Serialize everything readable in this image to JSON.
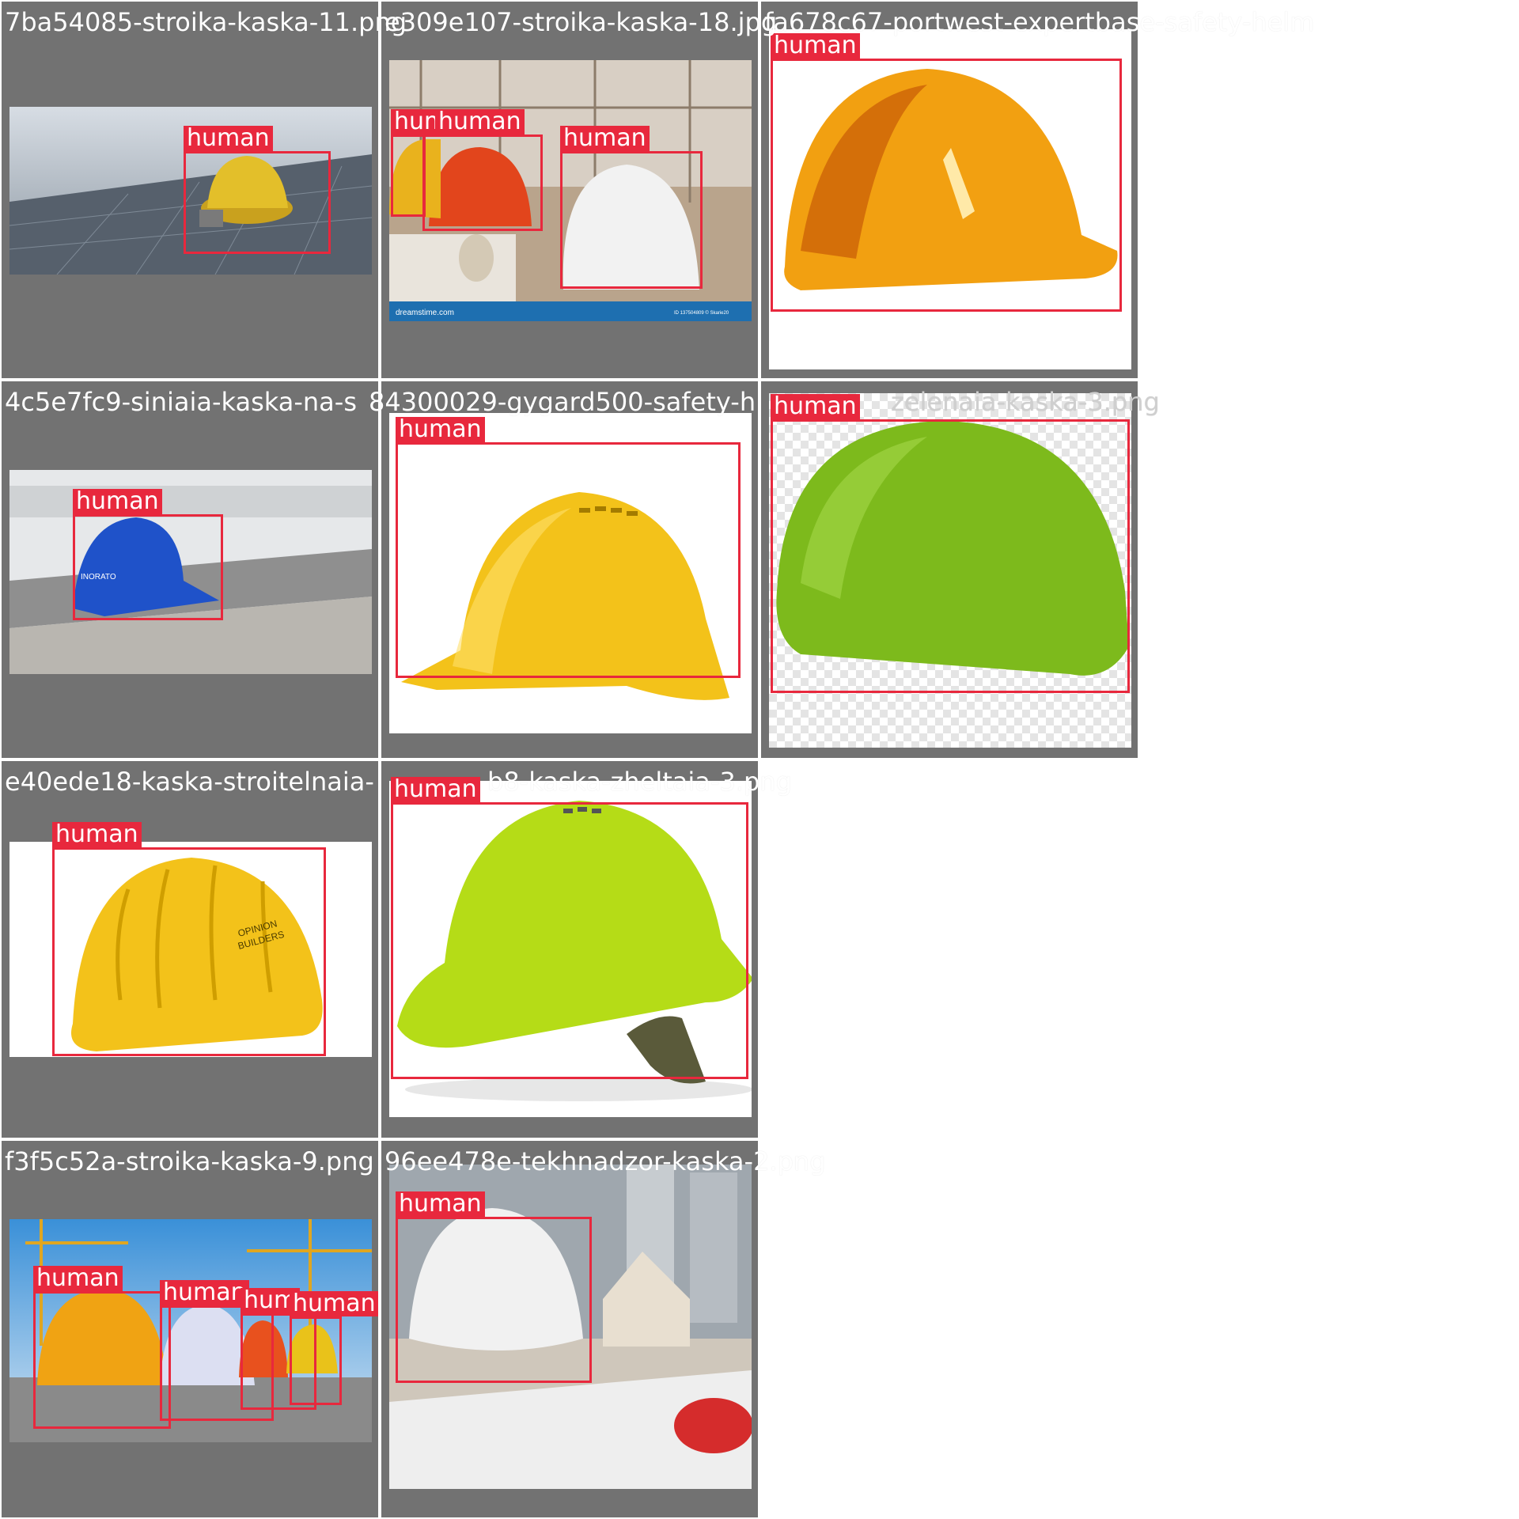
{
  "colors": {
    "tile_bg": "#727272",
    "box": "#e8283d",
    "label_text": "#ffffff"
  },
  "detection_class": "human",
  "tiles": [
    {
      "title": "7ba54085-stroika-kaska-11.png",
      "labels": [
        "human"
      ]
    },
    {
      "title": "e309e107-stroika-kaska-18.jpg",
      "labels": [
        "human",
        "human",
        "human"
      ]
    },
    {
      "title": "fa678c67-portwest-expertbase-safety-helm",
      "labels": [
        "human"
      ]
    },
    {
      "title": "4c5e7fc9-siniaia-kaska-na-s",
      "labels": [
        "human"
      ]
    },
    {
      "title": "84300029-gygard500-safety-h",
      "labels": [
        "human"
      ]
    },
    {
      "title": "zelenaia-kaska-3.png",
      "labels": [
        "human"
      ]
    },
    {
      "title": "e40ede18-kaska-stroitelnaia-",
      "labels": [
        "human"
      ]
    },
    {
      "title": "b8-kaska-zheltaia-3.png",
      "labels": [
        "human"
      ]
    },
    {
      "title": "f3f5c52a-stroika-kaska-9.png",
      "labels": [
        "human",
        "human",
        "hum",
        "human"
      ]
    },
    {
      "title": "96ee478e-tekhnadzor-kaska-2.png",
      "labels": [
        "human"
      ]
    }
  ],
  "photo_text": {
    "dreamstime": "dreamstime.com",
    "dreamstime_id": "ID 137504809 © Skarie20",
    "inorato": "INORATO",
    "opinion": "OPINION",
    "builders": "BUILDERS"
  }
}
